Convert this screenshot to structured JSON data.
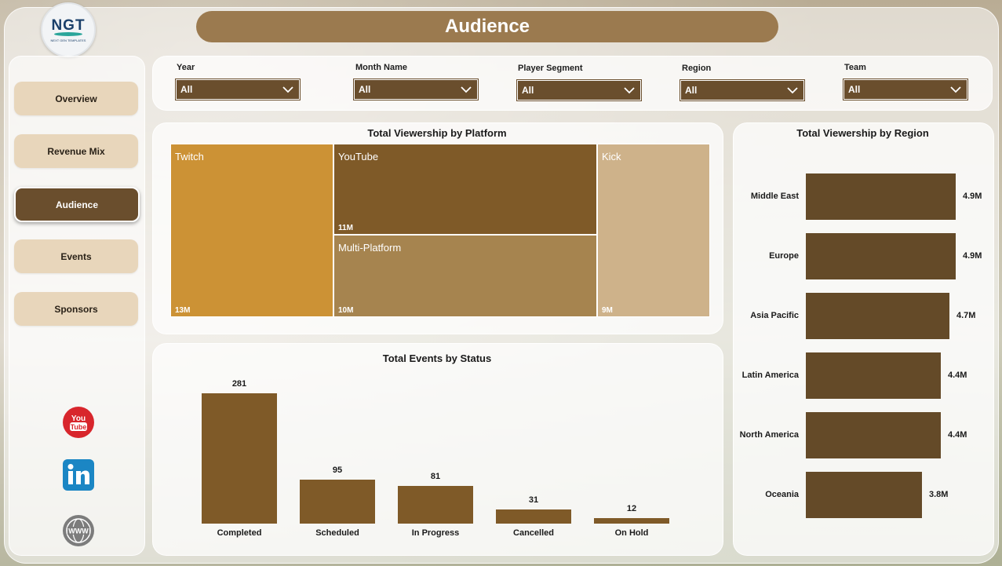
{
  "logo": {
    "text": "NGT",
    "subtext": "NEXT GEN TEMPLATES"
  },
  "header": {
    "title": "Audience"
  },
  "sidebar": {
    "items": [
      {
        "label": "Overview"
      },
      {
        "label": "Revenue Mix"
      },
      {
        "label": "Audience",
        "active": true
      },
      {
        "label": "Events"
      },
      {
        "label": "Sponsors"
      }
    ],
    "social_icons": [
      "youtube-icon",
      "linkedin-icon",
      "www-icon"
    ]
  },
  "filters": [
    {
      "label": "Year",
      "value": "All"
    },
    {
      "label": "Month Name",
      "value": "All"
    },
    {
      "label": "Player Segment",
      "value": "All"
    },
    {
      "label": "Region",
      "value": "All"
    },
    {
      "label": "Team",
      "value": "All"
    }
  ],
  "colors": {
    "accent_dark": "#6a4e2d",
    "title_bar": "#9b7a4f",
    "nav_inactive": "#e8d6bb",
    "twitch": "#cc9235",
    "youtube": "#7f5a28",
    "multi_platform": "#a6844f",
    "kick": "#ceb28a",
    "bar": "#7f5a28",
    "region_bar": "#644a28"
  },
  "chart_data": [
    {
      "type": "treemap",
      "title": "Total Viewership by Platform",
      "items": [
        {
          "name": "Twitch",
          "value": 13,
          "label": "13M"
        },
        {
          "name": "YouTube",
          "value": 11,
          "label": "11M"
        },
        {
          "name": "Multi-Platform",
          "value": 10,
          "label": "10M"
        },
        {
          "name": "Kick",
          "value": 9,
          "label": "9M"
        }
      ]
    },
    {
      "type": "bar",
      "title": "Total Events by Status",
      "categories": [
        "Completed",
        "Scheduled",
        "In Progress",
        "Cancelled",
        "On Hold"
      ],
      "values": [
        281,
        95,
        81,
        31,
        12
      ]
    },
    {
      "type": "bar",
      "orientation": "horizontal",
      "title": "Total Viewership by Region",
      "categories": [
        "Middle East",
        "Europe",
        "Asia Pacific",
        "Latin America",
        "North America",
        "Oceania"
      ],
      "values": [
        4.9,
        4.9,
        4.7,
        4.4,
        4.4,
        3.8
      ],
      "labels": [
        "4.9M",
        "4.9M",
        "4.7M",
        "4.4M",
        "4.4M",
        "3.8M"
      ]
    }
  ]
}
